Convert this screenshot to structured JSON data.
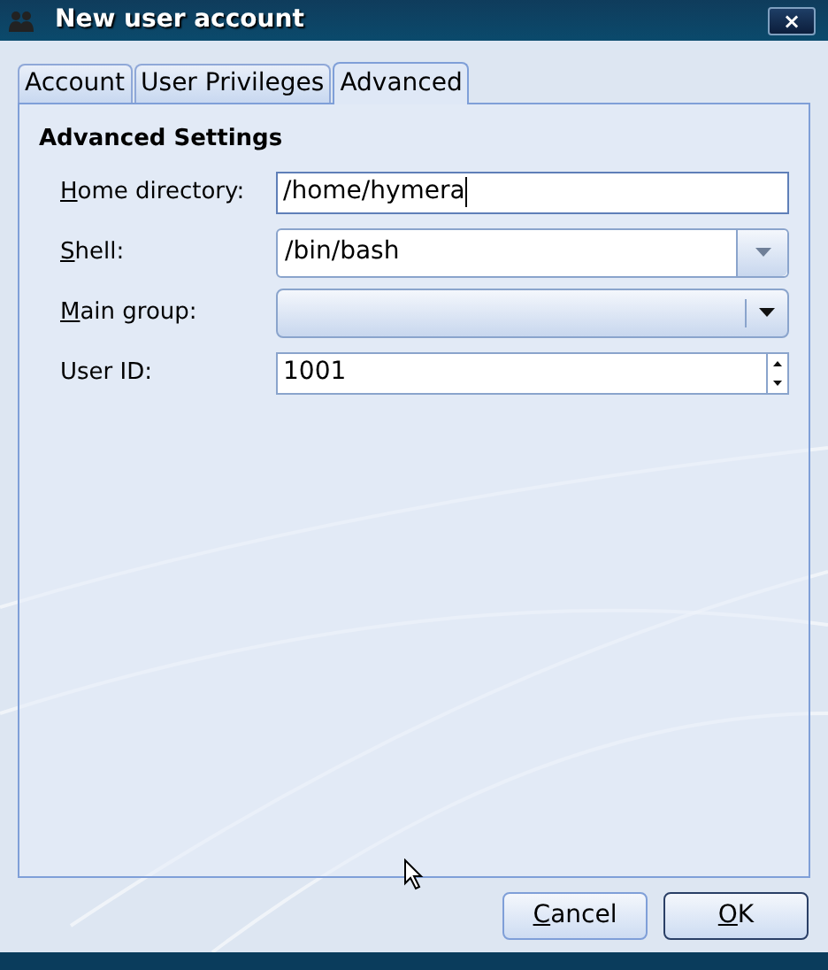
{
  "window": {
    "title": "New user account",
    "close": "×"
  },
  "tabs": [
    {
      "label": "Account",
      "selected": false
    },
    {
      "label": "User Privileges",
      "selected": false
    },
    {
      "label": "Advanced",
      "selected": true
    }
  ],
  "section": {
    "title": "Advanced Settings"
  },
  "fields": [
    {
      "kind": "text",
      "label": "Home directory:",
      "access_key": true,
      "value": "/home/hymera",
      "focused": true
    },
    {
      "kind": "editable_combo",
      "label": "Shell:",
      "access_key": true,
      "value": "/bin/bash",
      "focused": false
    },
    {
      "kind": "combo",
      "label": "Main group:",
      "access_key": true,
      "focused": false
    },
    {
      "kind": "spin",
      "label": "User ID:",
      "access_key": false,
      "value": "1001",
      "focused": false
    }
  ],
  "buttons": [
    {
      "label": "Cancel",
      "access_key": true,
      "default": false
    },
    {
      "label": "OK",
      "access_key": true,
      "default": true
    }
  ]
}
